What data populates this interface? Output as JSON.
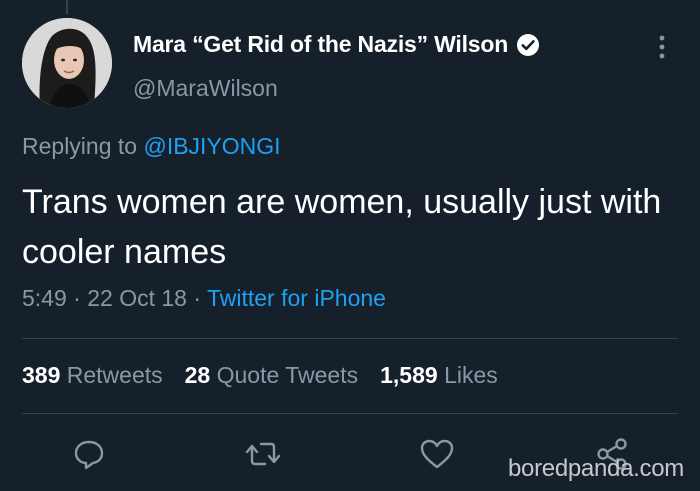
{
  "tweet": {
    "author": {
      "display_name": "Mara “Get Rid of the Nazis” Wilson",
      "handle": "@MaraWilson",
      "verified": true
    },
    "replying_prefix": "Replying to ",
    "replying_to": "@IBJIYONGI",
    "text": "Trans women are women, usually just with cooler names",
    "time": "5:49",
    "date": "22 Oct 18",
    "source": "Twitter for iPhone",
    "separator": " · "
  },
  "stats": {
    "retweets_count": "389",
    "retweets_label": "Retweets",
    "quote_count": "28",
    "quote_label": "Quote Tweets",
    "likes_count": "1,589",
    "likes_label": "Likes"
  },
  "actions": [
    "reply-icon",
    "retweet-icon",
    "like-icon",
    "share-icon"
  ],
  "watermark": "boredpanda.com",
  "colors": {
    "background": "#15202b",
    "accent": "#1da1f2",
    "secondary_text": "#8899a6",
    "divider": "#38444d"
  }
}
